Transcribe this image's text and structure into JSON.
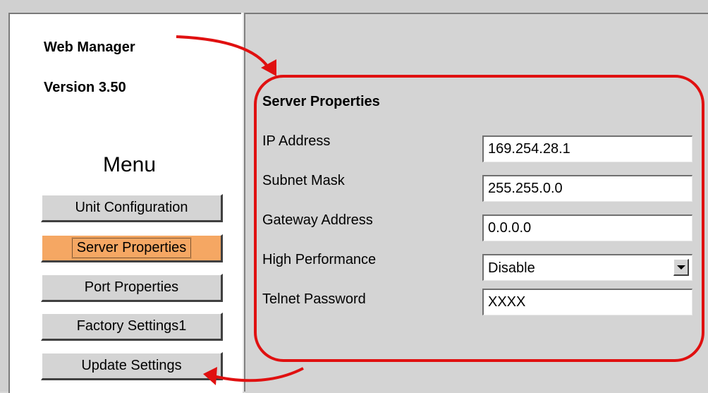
{
  "app": {
    "title": "Web Manager",
    "version": "Version 3.50"
  },
  "menu": {
    "heading": "Menu",
    "items": [
      {
        "label": "Unit Configuration",
        "active": false
      },
      {
        "label": "Server Properties",
        "active": true
      },
      {
        "label": "Port Properties",
        "active": false
      },
      {
        "label": "Factory Settings1",
        "active": false
      },
      {
        "label": "Update Settings",
        "active": false
      }
    ]
  },
  "server_properties": {
    "title": "Server Properties",
    "fields": {
      "ip_address": {
        "label": "IP Address",
        "value": "169.254.28.1"
      },
      "subnet_mask": {
        "label": "Subnet Mask",
        "value": "255.255.0.0"
      },
      "gateway_address": {
        "label": "Gateway Address",
        "value": "0.0.0.0"
      },
      "high_performance": {
        "label": "High Performance",
        "value": "Disable"
      },
      "telnet_password": {
        "label": "Telnet Password",
        "value": "XXXX"
      }
    }
  },
  "colors": {
    "active_button": "#f5a763",
    "annotation": "#e01010",
    "panel_bg": "#d4d4d4"
  }
}
